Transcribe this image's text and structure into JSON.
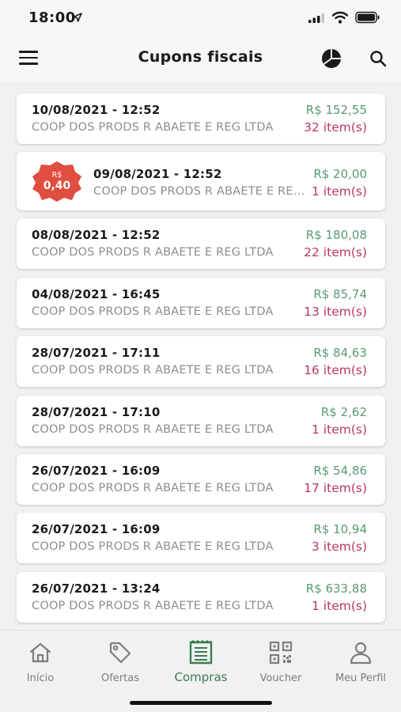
{
  "status_bar": {
    "time": "18:00"
  },
  "header": {
    "title": "Cupons fiscais"
  },
  "colors": {
    "value_green": "#5a9a72",
    "items_red": "#b9385c",
    "badge_red": "#e04e3f",
    "active_green": "#3a7d4f"
  },
  "receipts": [
    {
      "date": "10/08/2021 - 12:52",
      "store": "COOP DOS PRODS R ABAETE E REG LTDA",
      "value": "R$ 152,55",
      "items": "32 item(s)"
    },
    {
      "date": "09/08/2021 - 12:52",
      "store": "COOP DOS PRODS R ABAETE E REG LTDA",
      "value": "R$ 20,00",
      "items": "1 item(s)",
      "badge": {
        "top": "R$",
        "value": "0,40"
      }
    },
    {
      "date": "08/08/2021 - 12:52",
      "store": "COOP DOS PRODS R ABAETE E REG LTDA",
      "value": "R$ 180,08",
      "items": "22 item(s)"
    },
    {
      "date": "04/08/2021 - 16:45",
      "store": "COOP DOS PRODS R ABAETE E REG LTDA",
      "value": "R$ 85,74",
      "items": "13 item(s)"
    },
    {
      "date": "28/07/2021 - 17:11",
      "store": "COOP DOS PRODS R ABAETE E REG LTDA",
      "value": "R$ 84,63",
      "items": "16 item(s)"
    },
    {
      "date": "28/07/2021 - 17:10",
      "store": "COOP DOS PRODS R ABAETE E REG LTDA",
      "value": "R$ 2,62",
      "items": "1 item(s)"
    },
    {
      "date": "26/07/2021 - 16:09",
      "store": "COOP DOS PRODS R ABAETE E REG LTDA",
      "value": "R$ 54,86",
      "items": "17 item(s)"
    },
    {
      "date": "26/07/2021 - 16:09",
      "store": "COOP DOS PRODS R ABAETE E REG LTDA",
      "value": "R$ 10,94",
      "items": "3 item(s)"
    },
    {
      "date": "26/07/2021 - 13:24",
      "store": "COOP DOS PRODS R ABAETE E REG LTDA",
      "value": "R$ 633,88",
      "items": "1 item(s)"
    }
  ],
  "bottom_nav": [
    {
      "label": "Início",
      "icon": "home-icon",
      "active": false
    },
    {
      "label": "Ofertas",
      "icon": "tag-icon",
      "active": false
    },
    {
      "label": "Compras",
      "icon": "receipt-icon",
      "active": true
    },
    {
      "label": "Voucher",
      "icon": "qr-code-icon",
      "active": false
    },
    {
      "label": "Meu Perfil",
      "icon": "user-icon",
      "active": false
    }
  ]
}
